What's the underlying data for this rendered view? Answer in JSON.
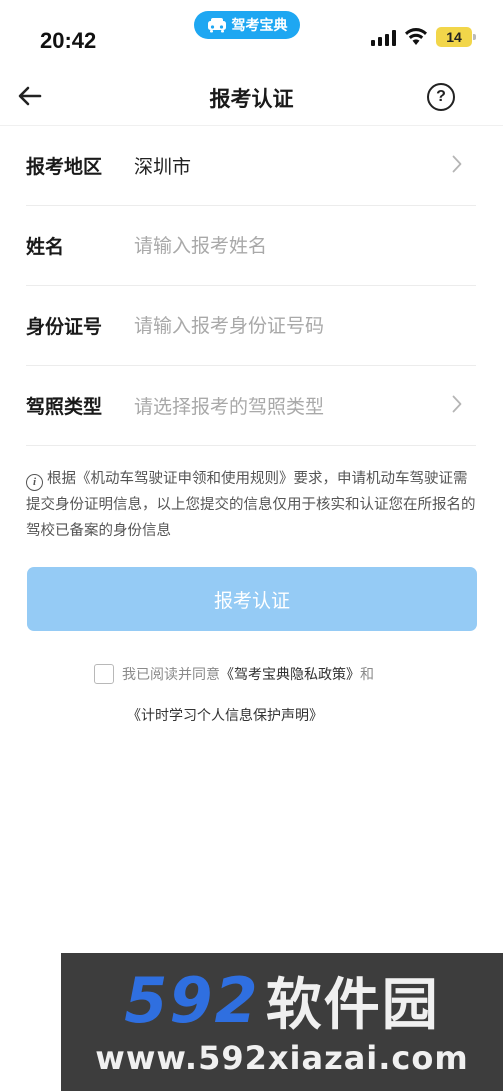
{
  "status_bar": {
    "time": "20:42",
    "app_badge": "驾考宝典",
    "battery": "14",
    "icons": [
      "car-icon",
      "signal-icon",
      "wifi-icon",
      "battery-icon"
    ]
  },
  "nav": {
    "title": "报考认证",
    "back_icon": "arrow-left-icon",
    "help_glyph": "?"
  },
  "form": {
    "region": {
      "label": "报考地区",
      "value": "深圳市"
    },
    "name": {
      "label": "姓名",
      "placeholder": "请输入报考姓名"
    },
    "id_number": {
      "label": "身份证号",
      "placeholder": "请输入报考身份证号码"
    },
    "license_type": {
      "label": "驾照类型",
      "placeholder": "请选择报考的驾照类型"
    }
  },
  "notice": {
    "icon_glyph": "i",
    "text": "根据《机动车驾驶证申领和使用规则》要求，申请机动车驾驶证需提交身份证明信息，以上您提交的信息仅用于核实和认证您在所报名的驾校已备案的身份信息"
  },
  "submit_label": "报考认证",
  "agreement": {
    "prefix": "我已阅读并同意",
    "privacy_link": "《驾考宝典隐私政策》",
    "conjunction": "和",
    "statement_link": "《计时学习个人信息保护声明》",
    "checked": false
  },
  "watermark": {
    "number": "592",
    "name": "软件园",
    "url": "www.592xiazai.com"
  },
  "colors": {
    "accent": "#1ea7f2",
    "button_disabled": "#95cbf5",
    "placeholder": "#a9a9a9",
    "battery": "#f2d64a"
  }
}
